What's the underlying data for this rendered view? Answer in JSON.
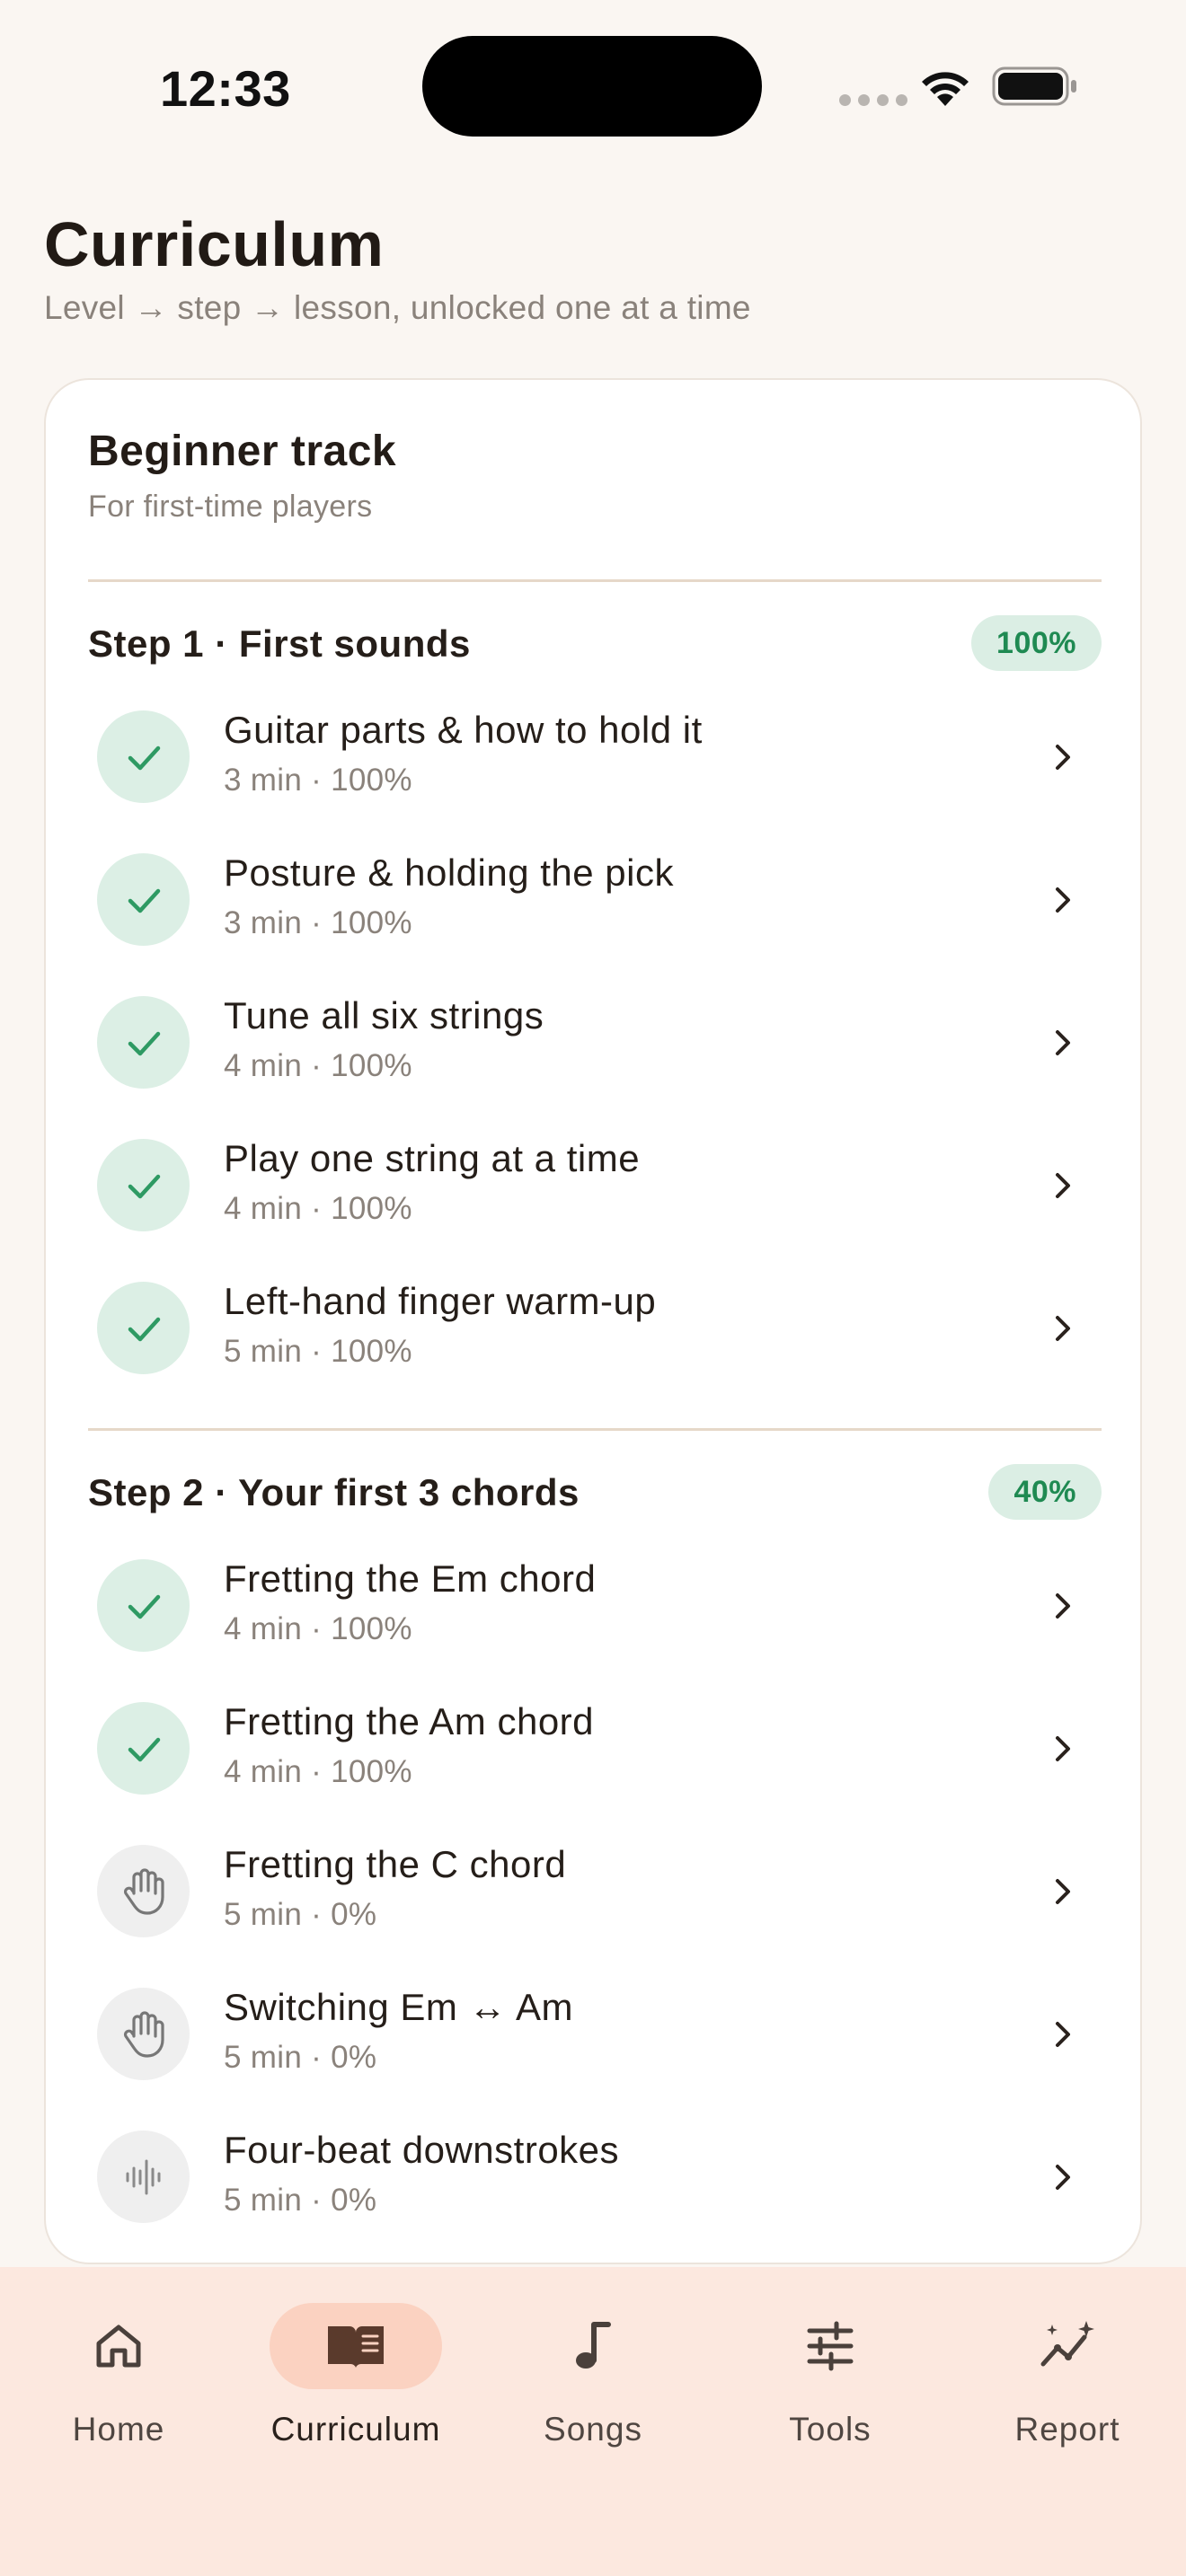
{
  "status_bar": {
    "time": "12:33"
  },
  "header": {
    "title": "Curriculum",
    "subtitle": "Level → step → lesson, unlocked one at a time"
  },
  "track": {
    "title": "Beginner track",
    "subtitle": "For first-time players",
    "steps": [
      {
        "title": "Step 1 · First sounds",
        "progress_label": "100%",
        "lessons": [
          {
            "title": "Guitar parts & how to hold it",
            "meta": "3 min · 100%",
            "status": "done",
            "icon": "check-icon"
          },
          {
            "title": "Posture & holding the pick",
            "meta": "3 min · 100%",
            "status": "done",
            "icon": "check-icon"
          },
          {
            "title": "Tune all six strings",
            "meta": "4 min · 100%",
            "status": "done",
            "icon": "check-icon"
          },
          {
            "title": "Play one string at a time",
            "meta": "4 min · 100%",
            "status": "done",
            "icon": "check-icon"
          },
          {
            "title": "Left-hand finger warm-up",
            "meta": "5 min · 100%",
            "status": "done",
            "icon": "check-icon"
          }
        ]
      },
      {
        "title": "Step 2 · Your first 3 chords",
        "progress_label": "40%",
        "lessons": [
          {
            "title": "Fretting the Em chord",
            "meta": "4 min · 100%",
            "status": "done",
            "icon": "check-icon"
          },
          {
            "title": "Fretting the Am chord",
            "meta": "4 min · 100%",
            "status": "done",
            "icon": "check-icon"
          },
          {
            "title": "Fretting the C chord",
            "meta": "5 min · 0%",
            "status": "todo",
            "icon": "hand-icon"
          },
          {
            "title": "Switching Em ↔ Am",
            "meta": "5 min · 0%",
            "status": "todo",
            "icon": "hand-icon"
          },
          {
            "title": "Four-beat downstrokes",
            "meta": "5 min · 0%",
            "status": "todo",
            "icon": "waveform-icon"
          }
        ]
      }
    ]
  },
  "tab_bar": {
    "active": "Curriculum",
    "tabs": [
      {
        "label": "Home",
        "icon": "home-icon"
      },
      {
        "label": "Curriculum",
        "icon": "book-icon"
      },
      {
        "label": "Songs",
        "icon": "music-note-icon"
      },
      {
        "label": "Tools",
        "icon": "sliders-icon"
      },
      {
        "label": "Report",
        "icon": "trend-sparkle-icon"
      }
    ]
  },
  "colors": {
    "background": "#faf6f2",
    "done_circle": "#dcefe5",
    "done_check": "#2e9a63",
    "badge_bg": "#dbeee4",
    "badge_text": "#1f8a52",
    "tab_bar_bg": "#fce8df",
    "tab_active_pill": "#fbd2c1",
    "book_icon": "#5a3a2c"
  }
}
